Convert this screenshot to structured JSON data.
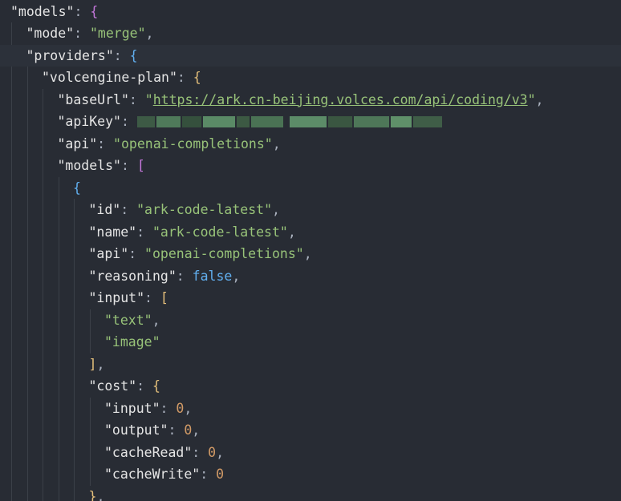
{
  "editor": {
    "colors": {
      "background": "#282c34",
      "current_line": "#2c313a",
      "key": "#e5e5e5",
      "string": "#98c379",
      "number": "#d19a66",
      "boolean": "#61afef",
      "bracket_1": "#e5c07b",
      "bracket_2": "#c678dd",
      "bracket_3": "#61afef",
      "punctuation": "#abb2bf"
    },
    "lines": [
      {
        "tokens": [
          {
            "t": "key",
            "v": "\"models\""
          },
          {
            "t": "p",
            "v": ": "
          },
          {
            "t": "b2",
            "v": "{"
          }
        ]
      },
      {
        "tokens": [
          {
            "t": "key",
            "v": "\"mode\""
          },
          {
            "t": "p",
            "v": ": "
          },
          {
            "t": "str",
            "v": "\"merge\""
          },
          {
            "t": "p",
            "v": ","
          }
        ]
      },
      {
        "tokens": [
          {
            "t": "key",
            "v": "\"providers\""
          },
          {
            "t": "p",
            "v": ": "
          },
          {
            "t": "b3",
            "v": "{"
          }
        ]
      },
      {
        "tokens": [
          {
            "t": "key",
            "v": "\"volcengine-plan\""
          },
          {
            "t": "p",
            "v": ": "
          },
          {
            "t": "b1",
            "v": "{"
          }
        ]
      },
      {
        "tokens": [
          {
            "t": "key",
            "v": "\"baseUrl\""
          },
          {
            "t": "p",
            "v": ": "
          },
          {
            "t": "str",
            "v": "\""
          },
          {
            "t": "url",
            "v": "https://ark.cn-beijing.volces.com/api/coding/v3"
          },
          {
            "t": "str",
            "v": "\""
          },
          {
            "t": "p",
            "v": ","
          }
        ]
      },
      {
        "tokens": [
          {
            "t": "key",
            "v": "\"apiKey\""
          },
          {
            "t": "p",
            "v": ": "
          },
          {
            "t": "redacted",
            "v": ""
          }
        ]
      },
      {
        "tokens": [
          {
            "t": "key",
            "v": "\"api\""
          },
          {
            "t": "p",
            "v": ": "
          },
          {
            "t": "str",
            "v": "\"openai-completions\""
          },
          {
            "t": "p",
            "v": ","
          }
        ]
      },
      {
        "tokens": [
          {
            "t": "key",
            "v": "\"models\""
          },
          {
            "t": "p",
            "v": ": "
          },
          {
            "t": "b2",
            "v": "["
          }
        ]
      },
      {
        "tokens": [
          {
            "t": "b3",
            "v": "{"
          }
        ]
      },
      {
        "tokens": [
          {
            "t": "key",
            "v": "\"id\""
          },
          {
            "t": "p",
            "v": ": "
          },
          {
            "t": "str",
            "v": "\"ark-code-latest\""
          },
          {
            "t": "p",
            "v": ","
          }
        ]
      },
      {
        "tokens": [
          {
            "t": "key",
            "v": "\"name\""
          },
          {
            "t": "p",
            "v": ": "
          },
          {
            "t": "str",
            "v": "\"ark-code-latest\""
          },
          {
            "t": "p",
            "v": ","
          }
        ]
      },
      {
        "tokens": [
          {
            "t": "key",
            "v": "\"api\""
          },
          {
            "t": "p",
            "v": ": "
          },
          {
            "t": "str",
            "v": "\"openai-completions\""
          },
          {
            "t": "p",
            "v": ","
          }
        ]
      },
      {
        "tokens": [
          {
            "t": "key",
            "v": "\"reasoning\""
          },
          {
            "t": "p",
            "v": ": "
          },
          {
            "t": "kw",
            "v": "false"
          },
          {
            "t": "p",
            "v": ","
          }
        ]
      },
      {
        "tokens": [
          {
            "t": "key",
            "v": "\"input\""
          },
          {
            "t": "p",
            "v": ": "
          },
          {
            "t": "b1",
            "v": "["
          }
        ]
      },
      {
        "tokens": [
          {
            "t": "str",
            "v": "\"text\""
          },
          {
            "t": "p",
            "v": ","
          }
        ]
      },
      {
        "tokens": [
          {
            "t": "str",
            "v": "\"image\""
          }
        ]
      },
      {
        "tokens": [
          {
            "t": "b1",
            "v": "]"
          },
          {
            "t": "p",
            "v": ","
          }
        ]
      },
      {
        "tokens": [
          {
            "t": "key",
            "v": "\"cost\""
          },
          {
            "t": "p",
            "v": ": "
          },
          {
            "t": "b1",
            "v": "{"
          }
        ]
      },
      {
        "tokens": [
          {
            "t": "key",
            "v": "\"input\""
          },
          {
            "t": "p",
            "v": ": "
          },
          {
            "t": "num",
            "v": "0"
          },
          {
            "t": "p",
            "v": ","
          }
        ]
      },
      {
        "tokens": [
          {
            "t": "key",
            "v": "\"output\""
          },
          {
            "t": "p",
            "v": ": "
          },
          {
            "t": "num",
            "v": "0"
          },
          {
            "t": "p",
            "v": ","
          }
        ]
      },
      {
        "tokens": [
          {
            "t": "key",
            "v": "\"cacheRead\""
          },
          {
            "t": "p",
            "v": ": "
          },
          {
            "t": "num",
            "v": "0"
          },
          {
            "t": "p",
            "v": ","
          }
        ]
      },
      {
        "tokens": [
          {
            "t": "key",
            "v": "\"cacheWrite\""
          },
          {
            "t": "p",
            "v": ": "
          },
          {
            "t": "num",
            "v": "0"
          }
        ]
      },
      {
        "tokens": [
          {
            "t": "b1",
            "v": "}"
          },
          {
            "t": "p",
            "v": ","
          }
        ]
      }
    ]
  }
}
